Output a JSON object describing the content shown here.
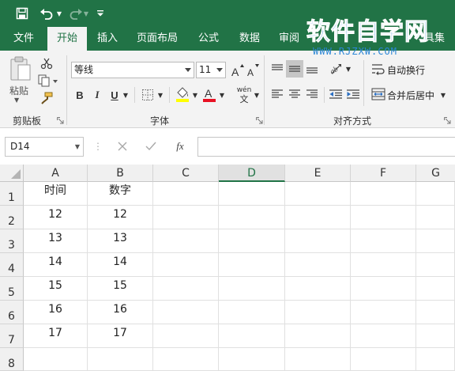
{
  "tabs": [
    {
      "label": "文件",
      "active": false
    },
    {
      "label": "开始",
      "active": true
    },
    {
      "label": "插入",
      "active": false
    },
    {
      "label": "页面布局",
      "active": false
    },
    {
      "label": "公式",
      "active": false
    },
    {
      "label": "数据",
      "active": false
    },
    {
      "label": "审阅",
      "active": false
    },
    {
      "label": "具集",
      "active": false
    }
  ],
  "watermark": {
    "main": "软件自学网",
    "url": "WWW.RJZXW.COM"
  },
  "ribbon": {
    "clipboard": {
      "paste_label": "粘贴",
      "group_label": "剪贴板"
    },
    "font": {
      "font_name": "等线",
      "font_size": "11",
      "bold": "B",
      "italic": "I",
      "underline": "U",
      "font_color_glyph": "A",
      "phonetic_glyph": "wén",
      "phonetic_sub": "文",
      "group_label": "字体"
    },
    "alignment": {
      "wrap_text": "自动换行",
      "merge_center": "合并后居中",
      "group_label": "对齐方式"
    }
  },
  "formula_bar": {
    "name_box": "D14",
    "fx_label": "fx",
    "formula": ""
  },
  "sheet": {
    "selected_column": "D",
    "columns": [
      "A",
      "B",
      "C",
      "D",
      "E",
      "F",
      "G"
    ],
    "rows": [
      "1",
      "2",
      "3",
      "4",
      "5",
      "6",
      "7",
      "8"
    ],
    "cells": [
      [
        "时间",
        "数字"
      ],
      [
        "12",
        "12"
      ],
      [
        "13",
        "13"
      ],
      [
        "14",
        "14"
      ],
      [
        "15",
        "15"
      ],
      [
        "16",
        "16"
      ],
      [
        "17",
        "17"
      ],
      [
        "",
        ""
      ]
    ]
  },
  "colors": {
    "brand": "#217346",
    "watermark": "#2a86d6",
    "font_highlight": "#ffff00",
    "font_color": "#e81123"
  },
  "icons": [
    "save-icon",
    "undo-icon",
    "redo-icon",
    "customize-qat-icon",
    "paste-icon",
    "cut-icon",
    "copy-icon",
    "format-painter-icon",
    "grow-font-icon",
    "shrink-font-icon",
    "borders-icon",
    "fill-color-icon",
    "font-color-icon",
    "phonetic-icon",
    "align-top-icon",
    "align-middle-icon",
    "align-bottom-icon",
    "orientation-icon",
    "wrap-text-icon",
    "align-left-icon",
    "align-center-icon",
    "align-right-icon",
    "decrease-indent-icon",
    "increase-indent-icon",
    "merge-center-icon",
    "cancel-icon",
    "enter-icon",
    "fx-icon"
  ]
}
